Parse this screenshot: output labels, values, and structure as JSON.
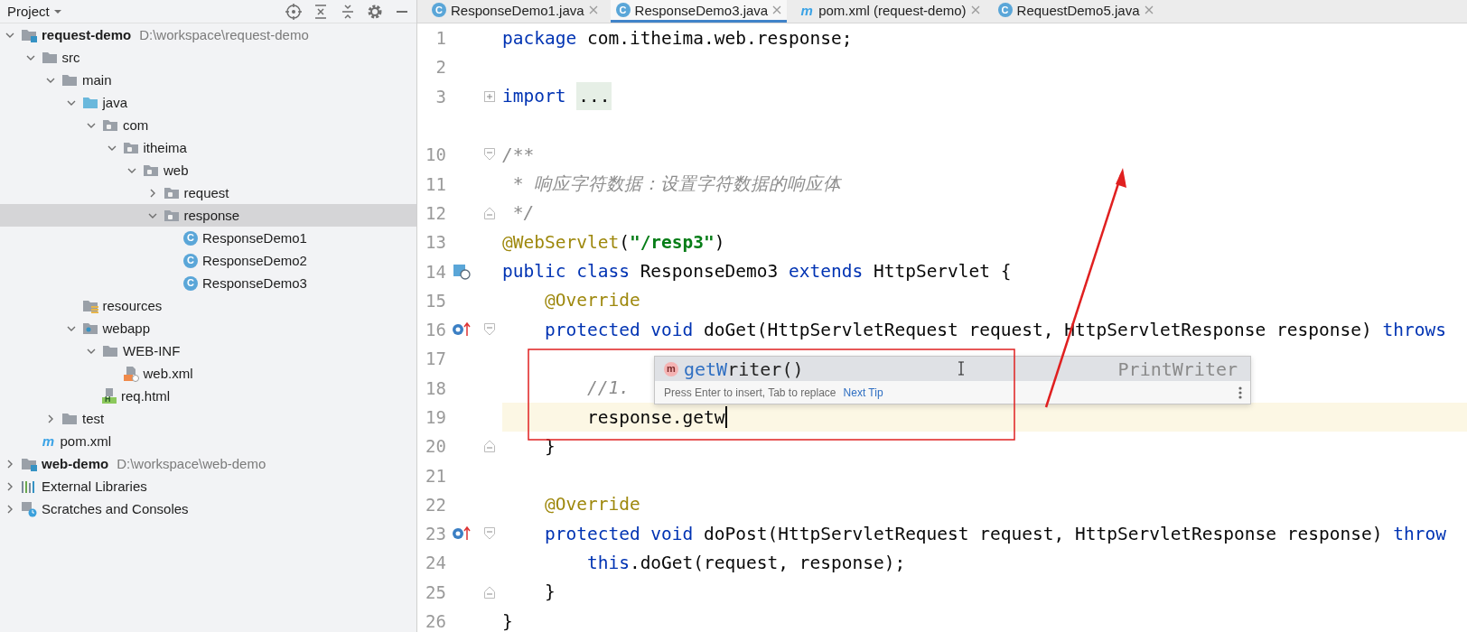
{
  "project_panel": {
    "title": "Project",
    "tree": [
      {
        "label": "request-demo",
        "path": "D:\\workspace\\request-demo",
        "kind": "module",
        "bold": true,
        "expanded": true,
        "selected": false,
        "children": [
          {
            "label": "src",
            "kind": "folder",
            "expanded": true,
            "selected": false,
            "children": [
              {
                "label": "main",
                "kind": "folder",
                "expanded": true,
                "selected": false,
                "children": [
                  {
                    "label": "java",
                    "kind": "source",
                    "expanded": true,
                    "selected": false,
                    "children": [
                      {
                        "label": "com",
                        "kind": "package",
                        "expanded": true,
                        "selected": false,
                        "children": [
                          {
                            "label": "itheima",
                            "kind": "package",
                            "expanded": true,
                            "selected": false,
                            "children": [
                              {
                                "label": "web",
                                "kind": "package",
                                "expanded": true,
                                "selected": false,
                                "children": [
                                  {
                                    "label": "request",
                                    "kind": "package",
                                    "expanded": false,
                                    "selected": false
                                  },
                                  {
                                    "label": "response",
                                    "kind": "package",
                                    "expanded": true,
                                    "selected": true,
                                    "children": [
                                      {
                                        "label": "ResponseDemo1",
                                        "kind": "class",
                                        "badge": "C",
                                        "selected": false
                                      },
                                      {
                                        "label": "ResponseDemo2",
                                        "kind": "class",
                                        "badge": "C",
                                        "selected": false
                                      },
                                      {
                                        "label": "ResponseDemo3",
                                        "kind": "class",
                                        "badge": "C",
                                        "selected": false
                                      }
                                    ]
                                  }
                                ]
                              }
                            ]
                          }
                        ]
                      }
                    ]
                  },
                  {
                    "label": "resources",
                    "kind": "resources",
                    "selected": false
                  },
                  {
                    "label": "webapp",
                    "kind": "web",
                    "expanded": true,
                    "selected": false,
                    "children": [
                      {
                        "label": "WEB-INF",
                        "kind": "folder",
                        "expanded": true,
                        "selected": false,
                        "children": [
                          {
                            "label": "web.xml",
                            "kind": "xml",
                            "selected": false
                          }
                        ]
                      },
                      {
                        "label": "req.html",
                        "kind": "html",
                        "badge": "H",
                        "selected": false
                      }
                    ]
                  }
                ]
              },
              {
                "label": "test",
                "kind": "folder",
                "expanded": false,
                "selected": false
              }
            ]
          },
          {
            "label": "pom.xml",
            "kind": "maven",
            "badge": "m",
            "selected": false
          }
        ]
      },
      {
        "label": "web-demo",
        "path": "D:\\workspace\\web-demo",
        "kind": "module",
        "bold": true,
        "expanded": false,
        "selected": false
      },
      {
        "label": "External Libraries",
        "kind": "libraries",
        "expanded": false,
        "selected": false
      },
      {
        "label": "Scratches and Consoles",
        "kind": "scratches",
        "expanded": false,
        "selected": false
      }
    ]
  },
  "tabs": [
    {
      "kind": "class",
      "badge": "C",
      "label": "ResponseDemo1.java",
      "selected": false
    },
    {
      "kind": "class",
      "badge": "C",
      "label": "ResponseDemo3.java",
      "selected": true
    },
    {
      "kind": "maven",
      "badge": "m",
      "label": "pom.xml (request-demo)",
      "selected": false
    },
    {
      "kind": "class",
      "badge": "C",
      "label": "RequestDemo5.java",
      "selected": false
    }
  ],
  "editor": {
    "lines": [
      {
        "number": "1",
        "current": false,
        "tokens": [
          {
            "kind": "keyword",
            "text": "package"
          },
          {
            "kind": "plain",
            "text": " com.itheima.web.response;"
          }
        ]
      },
      {
        "number": "2",
        "current": false
      },
      {
        "number": "3",
        "current": false,
        "fold": {
          "kind": "collapsed"
        },
        "tokens": [
          {
            "kind": "keyword",
            "text": "import "
          },
          {
            "kind": "folded",
            "text": "..."
          }
        ]
      },
      {
        "number": "10",
        "current": false,
        "fold": {
          "kind": "open"
        },
        "tokens": [
          {
            "kind": "comment",
            "text": "/**"
          }
        ]
      },
      {
        "number": "11",
        "current": false,
        "tokens": [
          {
            "kind": "comment",
            "text": " * 响应字符数据：设置字符数据的响应体"
          }
        ]
      },
      {
        "number": "12",
        "current": false,
        "fold": {
          "kind": "close"
        },
        "tokens": [
          {
            "kind": "comment",
            "text": " */"
          }
        ]
      },
      {
        "number": "13",
        "current": false,
        "tokens": [
          {
            "kind": "annotation",
            "text": "@WebServlet"
          },
          {
            "kind": "plain",
            "text": "("
          },
          {
            "kind": "string",
            "text": "\"/resp3\""
          },
          {
            "kind": "plain",
            "text": ")"
          }
        ]
      },
      {
        "number": "14",
        "current": false,
        "gutter": {
          "kind": "servlet"
        },
        "tokens": [
          {
            "kind": "keyword",
            "text": "public class"
          },
          {
            "kind": "plain",
            "text": " ResponseDemo3 "
          },
          {
            "kind": "keyword",
            "text": "extends"
          },
          {
            "kind": "plain",
            "text": " HttpServlet {"
          }
        ]
      },
      {
        "number": "15",
        "current": false,
        "tokens": [
          {
            "kind": "annotation",
            "text": "    @Override"
          }
        ]
      },
      {
        "number": "16",
        "current": false,
        "gutter": {
          "kind": "override"
        },
        "fold": {
          "kind": "open"
        },
        "tokens": [
          {
            "kind": "keyword",
            "text": "    protected void"
          },
          {
            "kind": "plain",
            "text": " doGet(HttpServletRequest request, HttpServletResponse response) "
          },
          {
            "kind": "keyword",
            "text": "throws"
          }
        ]
      },
      {
        "number": "17",
        "current": false
      },
      {
        "number": "18",
        "current": false,
        "tokens": [
          {
            "kind": "comment",
            "text": "        //1."
          }
        ]
      },
      {
        "number": "19",
        "current": true,
        "tokens": [
          {
            "kind": "plain",
            "text": "        response.getw"
          }
        ]
      },
      {
        "number": "20",
        "current": false,
        "fold": {
          "kind": "close"
        },
        "tokens": [
          {
            "kind": "plain",
            "text": "    }"
          }
        ]
      },
      {
        "number": "21",
        "current": false
      },
      {
        "number": "22",
        "current": false,
        "tokens": [
          {
            "kind": "annotation",
            "text": "    @Override"
          }
        ]
      },
      {
        "number": "23",
        "current": false,
        "gutter": {
          "kind": "override"
        },
        "fold": {
          "kind": "open"
        },
        "tokens": [
          {
            "kind": "keyword",
            "text": "    protected void"
          },
          {
            "kind": "plain",
            "text": " doPost(HttpServletRequest request, HttpServletResponse response) "
          },
          {
            "kind": "keyword",
            "text": "throw"
          }
        ]
      },
      {
        "number": "24",
        "current": false,
        "tokens": [
          {
            "kind": "keyword",
            "text": "        this"
          },
          {
            "kind": "plain",
            "text": ".doGet(request, response);"
          }
        ]
      },
      {
        "number": "25",
        "current": false,
        "fold": {
          "kind": "close"
        },
        "tokens": [
          {
            "kind": "plain",
            "text": "    }"
          }
        ]
      },
      {
        "number": "26",
        "current": false,
        "tokens": [
          {
            "kind": "plain",
            "text": "}"
          }
        ]
      }
    ],
    "completion": {
      "badge": "m",
      "match": "getW",
      "rest": "riter",
      "params": "()",
      "type": "PrintWriter",
      "hint": "Press Enter to insert, Tab to replace",
      "link": "Next Tip"
    }
  }
}
